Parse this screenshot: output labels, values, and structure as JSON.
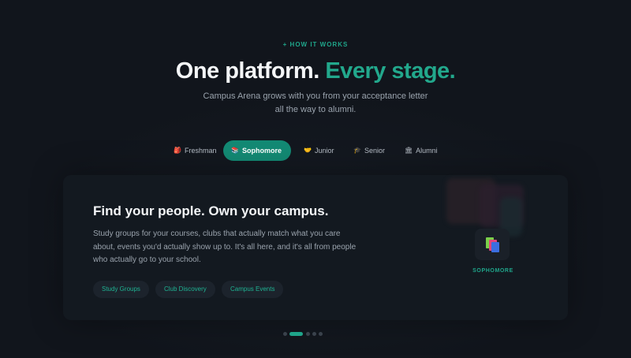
{
  "section": {
    "eyebrow": "+ HOW IT WORKS",
    "headline_part1": "One platform.",
    "headline_part2": "Every stage.",
    "subtitle_line1": "Campus Arena grows with you from your acceptance letter",
    "subtitle_line2": "all the way to alumni."
  },
  "tabs": [
    {
      "label": "Freshman",
      "icon": "🎒",
      "icon_name": "backpack-icon",
      "active": false
    },
    {
      "label": "Sophomore",
      "icon": "📚",
      "icon_name": "books-icon",
      "active": true
    },
    {
      "label": "Junior",
      "icon": "🤝",
      "icon_name": "handshake-icon",
      "active": false
    },
    {
      "label": "Senior",
      "icon": "🎓",
      "icon_name": "graduation-cap-icon",
      "active": false
    },
    {
      "label": "Alumni",
      "icon": "🏛",
      "icon_name": "institution-icon",
      "active": false
    }
  ],
  "panel": {
    "title": "Find your people. Own your campus.",
    "body": "Study groups for your courses, clubs that actually match what you care about, events you'd actually show up to. It's all here, and it's all from people who actually go to your school.",
    "chips": [
      "Study Groups",
      "Club Discovery",
      "Campus Events"
    ],
    "card_label": "SOPHOMORE"
  },
  "carousel": {
    "total": 5,
    "current": 2
  },
  "colors": {
    "background": "#11151c",
    "accent": "#22a88c",
    "active_tab": "#138a74",
    "text_muted": "#9aa3ad"
  }
}
